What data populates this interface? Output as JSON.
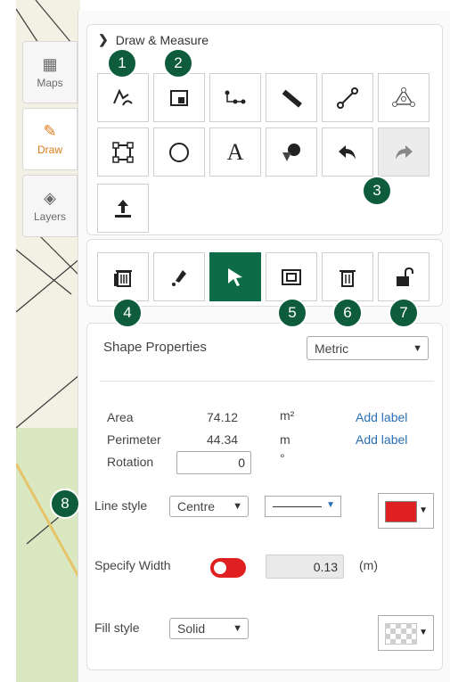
{
  "sidebar": {
    "tabs": [
      {
        "label": "Maps",
        "icon": "map-icon"
      },
      {
        "label": "Draw",
        "icon": "pencil-icon"
      },
      {
        "label": "Layers",
        "icon": "layers-icon"
      }
    ],
    "active_tab": "Draw"
  },
  "panel": {
    "title": "Draw & Measure",
    "badges": [
      "1",
      "2",
      "3",
      "4",
      "5",
      "6",
      "7",
      "8"
    ],
    "draw_tools": [
      {
        "icon": "freehand-polygon-icon",
        "glyph": "✍"
      },
      {
        "icon": "rectangle-tool-icon",
        "glyph": "▣"
      },
      {
        "icon": "polyline-measure-icon",
        "glyph": "⋰"
      },
      {
        "icon": "ruler-icon",
        "glyph": "📏"
      },
      {
        "icon": "line-tool-icon",
        "glyph": "⟋"
      },
      {
        "icon": "polygon-tool-icon",
        "glyph": "⟁"
      },
      {
        "icon": "square-tool-icon",
        "glyph": "▢"
      },
      {
        "icon": "circle-tool-icon",
        "glyph": "○"
      },
      {
        "icon": "text-tool-icon",
        "glyph": "A"
      },
      {
        "icon": "shapes-tool-icon",
        "glyph": "◆"
      },
      {
        "icon": "undo-icon",
        "glyph": "↶"
      },
      {
        "icon": "redo-icon",
        "glyph": "↷"
      },
      {
        "icon": "upload-icon",
        "glyph": "⤒"
      }
    ],
    "edit_tools": [
      {
        "icon": "delete-all-icon",
        "glyph": "🗑"
      },
      {
        "icon": "edit-vertices-icon",
        "glyph": "✒"
      },
      {
        "icon": "select-pointer-icon",
        "glyph": "➤"
      },
      {
        "icon": "select-box-icon",
        "glyph": "▣"
      },
      {
        "icon": "delete-icon",
        "glyph": "🗑"
      },
      {
        "icon": "unlock-icon",
        "glyph": "🔓"
      }
    ],
    "properties": {
      "title": "Shape Properties",
      "units_value": "Metric",
      "area_label": "Area",
      "area_value": "74.12",
      "area_unit": "m²",
      "perimeter_label": "Perimeter",
      "perimeter_value": "44.34",
      "perimeter_unit": "m",
      "rotation_label": "Rotation",
      "rotation_value": "0",
      "rotation_unit": "°",
      "add_label": "Add label",
      "line_style_label": "Line style",
      "line_style_value": "Centre",
      "line_color": "#e02020",
      "specify_width_label": "Specify Width",
      "width_value": "0.13",
      "width_unit": "(m)",
      "fill_style_label": "Fill style",
      "fill_style_value": "Solid"
    }
  }
}
